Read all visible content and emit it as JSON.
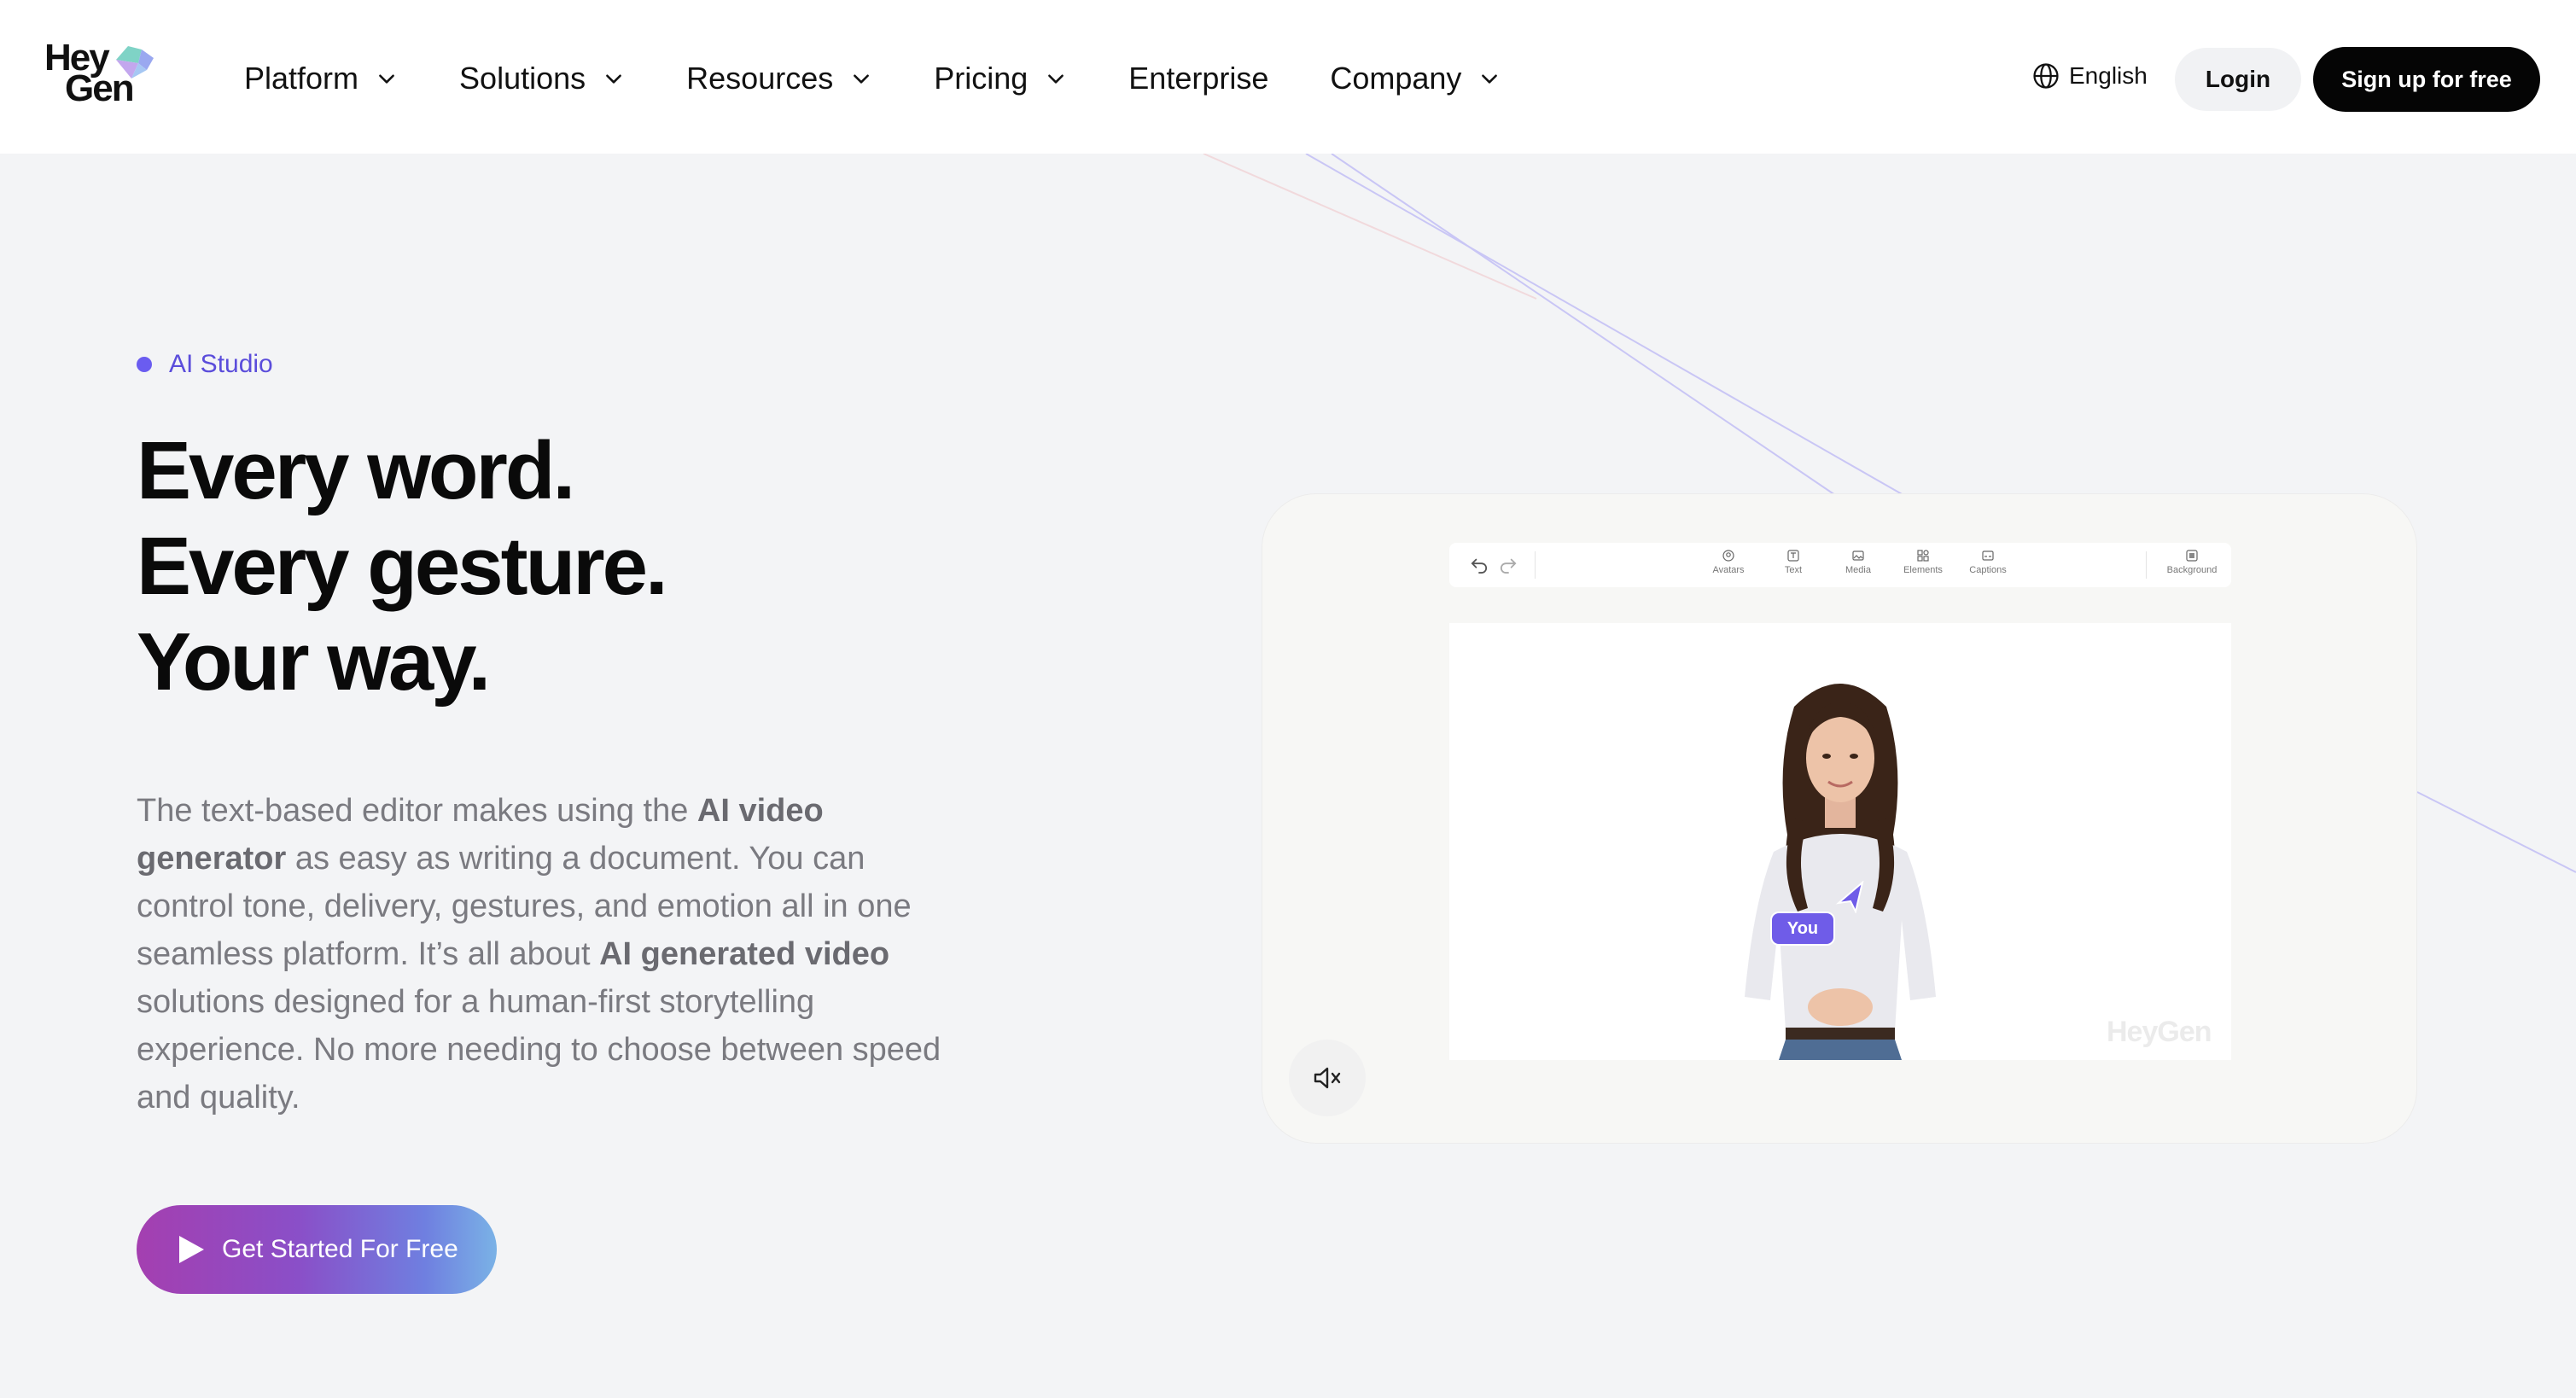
{
  "brand": {
    "logo_line1": "Hey",
    "logo_line2": "Gen",
    "accent": "#6a5cf0"
  },
  "nav": {
    "items": [
      {
        "label": "Platform",
        "has_dropdown": true
      },
      {
        "label": "Solutions",
        "has_dropdown": true
      },
      {
        "label": "Resources",
        "has_dropdown": true
      },
      {
        "label": "Pricing",
        "has_dropdown": true
      },
      {
        "label": "Enterprise",
        "has_dropdown": false
      },
      {
        "label": "Company",
        "has_dropdown": true
      }
    ],
    "language": "English",
    "login": "Login",
    "signup": "Sign up for free"
  },
  "hero": {
    "eyebrow": "AI Studio",
    "headline": [
      "Every word.",
      "Every gesture.",
      "Your way."
    ],
    "body": {
      "p1": "The text-based editor makes using the ",
      "b1": "AI video generator",
      "p2": " as easy as writing a document. You can control tone, delivery, gestures, and emotion all in one seamless platform. It’s all about ",
      "b2": "AI generated video",
      "p3": " solutions designed for a human-first storytelling experience. No more needing to choose between speed and quality."
    },
    "cta": "Get Started For Free"
  },
  "editor": {
    "tools": [
      "Avatars",
      "Text",
      "Media",
      "Elements",
      "Captions"
    ],
    "background_tool": "Background",
    "collaborator_tag": "You",
    "watermark": "HeyGen"
  }
}
